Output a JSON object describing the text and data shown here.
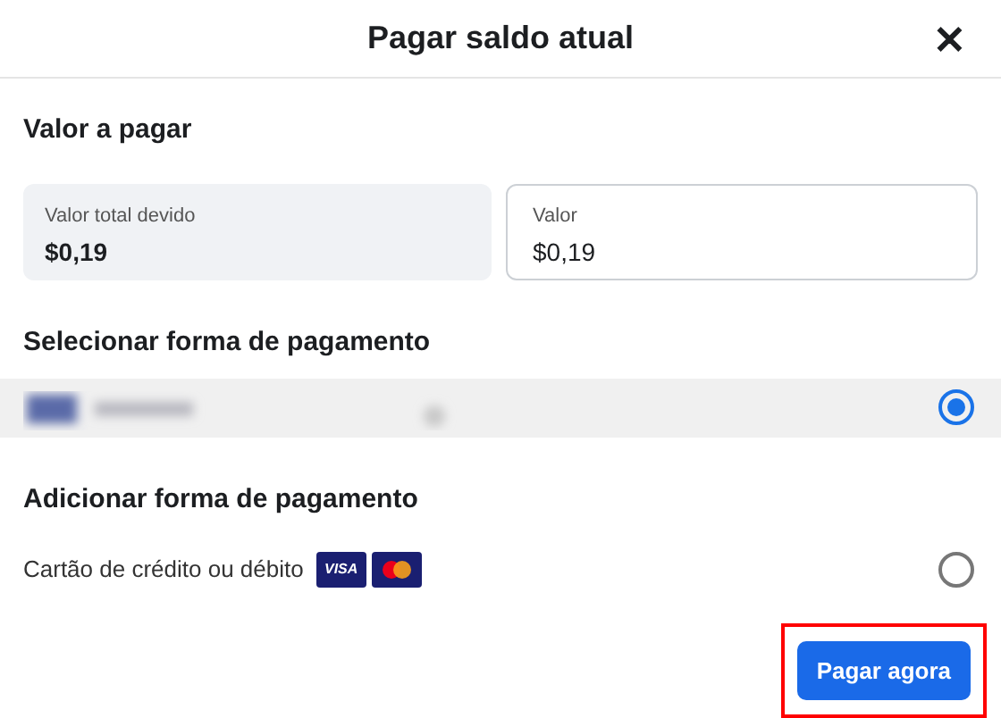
{
  "dialog": {
    "title": "Pagar saldo atual",
    "close": "✕"
  },
  "amount_section": {
    "heading": "Valor a pagar",
    "total": {
      "label": "Valor total devido",
      "value": "$0,19"
    },
    "field": {
      "label": "Valor",
      "value": "$0,19"
    }
  },
  "select_section": {
    "heading": "Selecionar forma de pagamento",
    "methods": [
      {
        "kind": "redacted",
        "selected": true
      }
    ]
  },
  "add_section": {
    "heading": "Adicionar forma de pagamento",
    "options": [
      {
        "label": "Cartão de crédito ou débito",
        "selected": false,
        "brands": [
          {
            "kind": "visa",
            "label": "VISA"
          },
          {
            "kind": "mastercard"
          }
        ]
      }
    ]
  },
  "pay_button": {
    "label": "Pagar agora",
    "highlighted": true
  }
}
